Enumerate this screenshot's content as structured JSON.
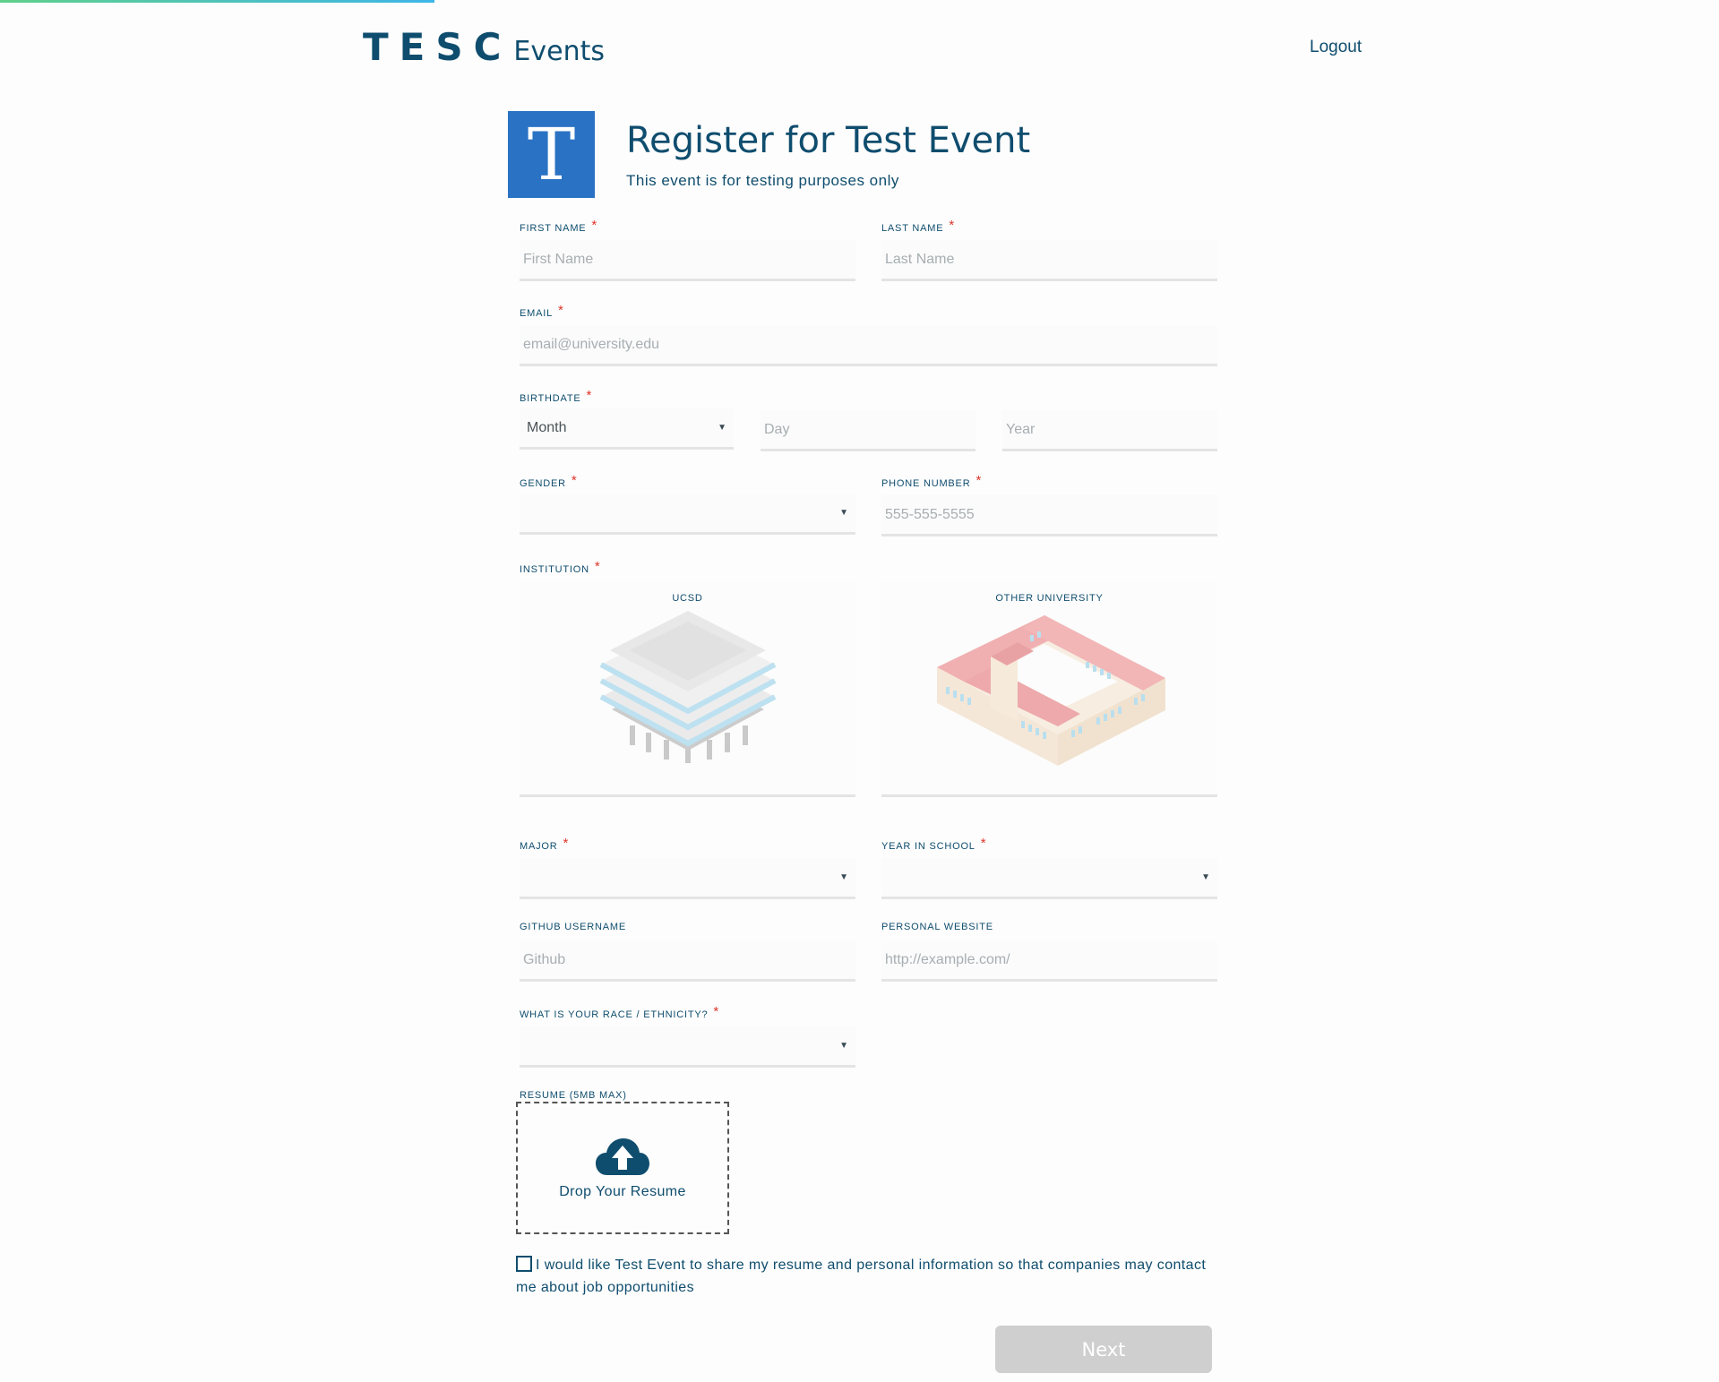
{
  "header": {
    "logo_tesc": "TESC",
    "logo_events": "Events",
    "logout": "Logout"
  },
  "event": {
    "logo_letter": "T",
    "title": "Register for Test Event",
    "subtitle": "This event is for testing purposes only"
  },
  "form": {
    "first_name": {
      "label": "FIRST NAME",
      "placeholder": "First Name"
    },
    "last_name": {
      "label": "LAST NAME",
      "placeholder": "Last Name"
    },
    "email": {
      "label": "EMAIL",
      "placeholder": "email@university.edu"
    },
    "birthdate": {
      "label": "BIRTHDATE",
      "month_value": "Month",
      "day_placeholder": "Day",
      "year_placeholder": "Year"
    },
    "gender": {
      "label": "GENDER",
      "value": ""
    },
    "phone": {
      "label": "PHONE NUMBER",
      "placeholder": "555-555-5555"
    },
    "institution": {
      "label": "INSTITUTION",
      "options": [
        "UCSD",
        "OTHER UNIVERSITY"
      ]
    },
    "major": {
      "label": "MAJOR",
      "value": ""
    },
    "year_in_school": {
      "label": "YEAR IN SCHOOL",
      "value": ""
    },
    "github": {
      "label": "GITHUB USERNAME",
      "placeholder": "Github"
    },
    "website": {
      "label": "PERSONAL WEBSITE",
      "placeholder": "http://example.com/"
    },
    "race": {
      "label": "WHAT IS YOUR RACE / ETHNICITY?",
      "value": ""
    },
    "resume": {
      "label": "RESUME (5MB MAX)",
      "drop_text": "Drop Your Resume"
    },
    "share_consent": "I would like Test Event to share my resume and personal information so that companies may contact me about job opportunities",
    "required_mark": "*",
    "next": "Next"
  },
  "icons": {
    "select_caret": "caret-down-icon",
    "upload": "cloud-upload-icon"
  },
  "colors": {
    "primary": "#0f4d6e",
    "event_logo_bg": "#2a72c4",
    "required": "#e0352b",
    "button_disabled": "#cfcfcf"
  }
}
